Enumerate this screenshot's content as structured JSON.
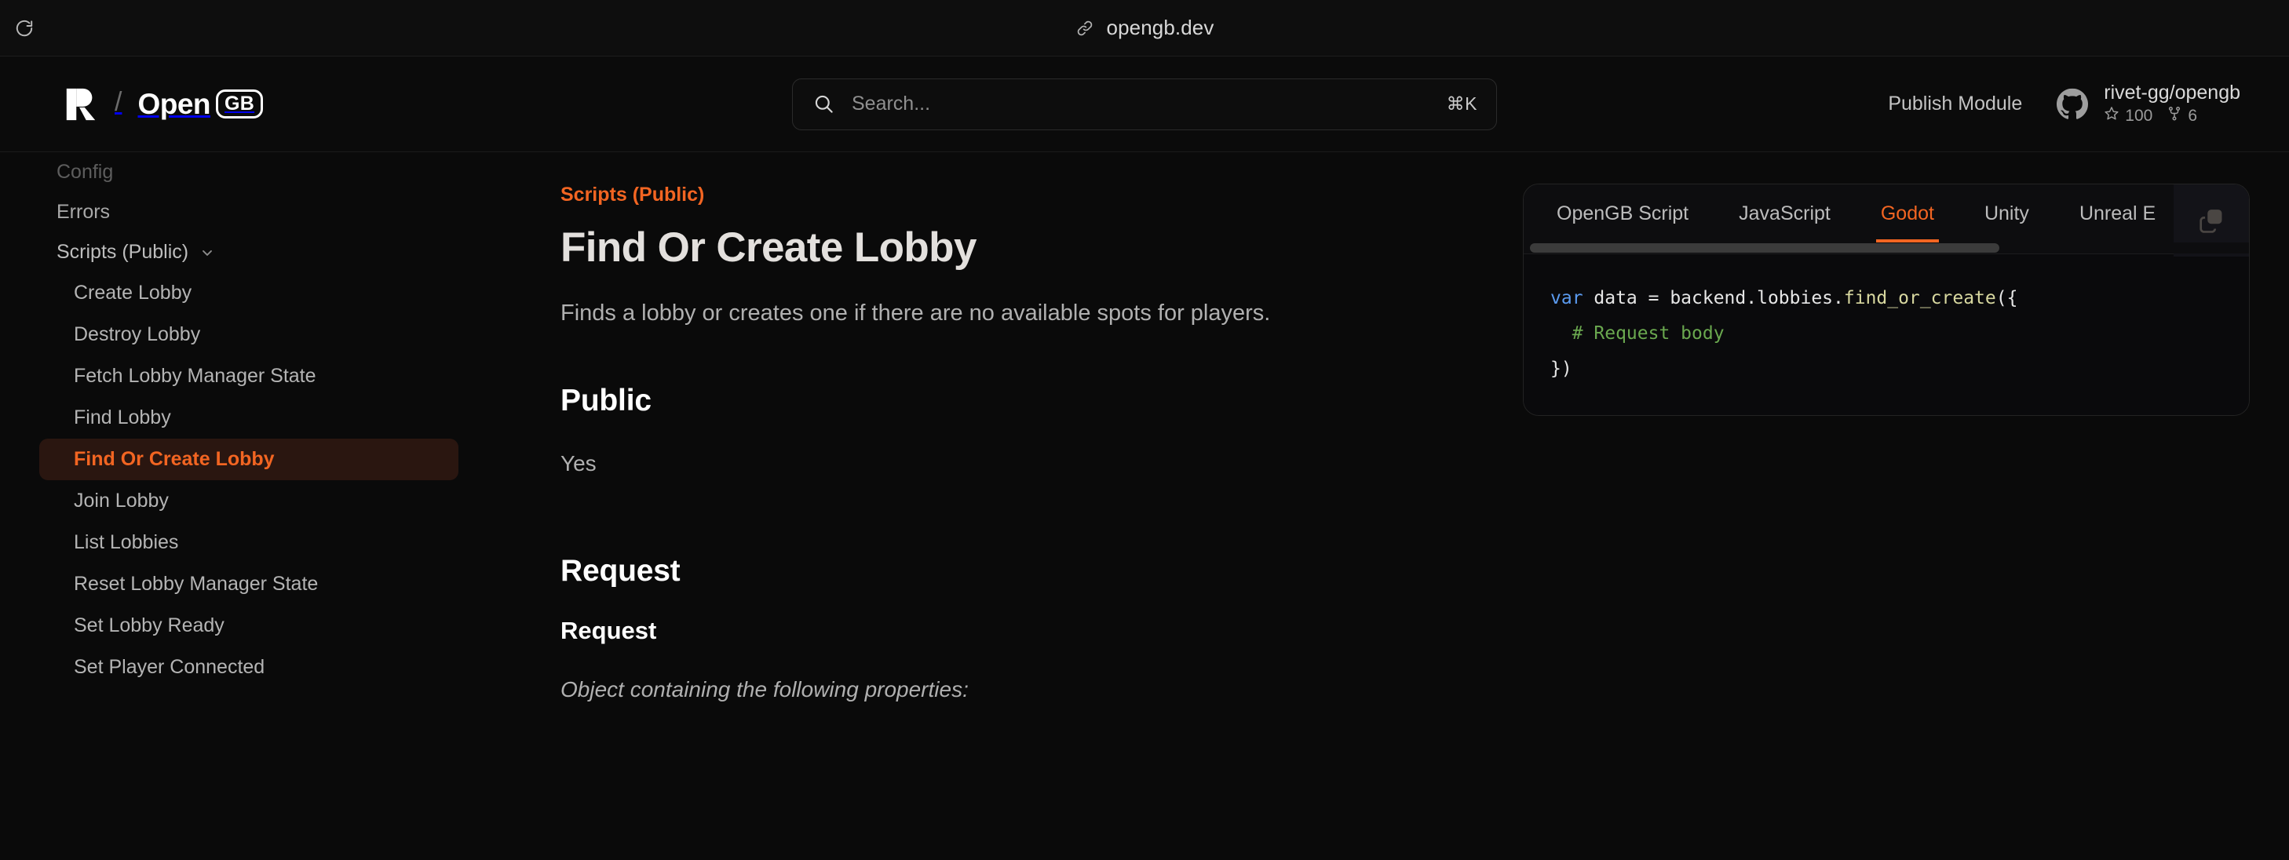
{
  "browser": {
    "reload_icon": "reload-icon",
    "link_icon": "link-icon",
    "url": "opengb.dev"
  },
  "header": {
    "brand": {
      "logo_icon": "rivet-logo-icon",
      "separator": "/",
      "product_word": "Open",
      "product_badge": "GB"
    },
    "search": {
      "icon": "search-icon",
      "value": "",
      "placeholder": "Search...",
      "shortcut": "⌘K"
    },
    "publish_label": "Publish Module",
    "repo": {
      "icon": "github-icon",
      "name": "rivet-gg/opengb",
      "stars_icon": "star-icon",
      "stars": "100",
      "forks_icon": "fork-icon",
      "forks": "6"
    }
  },
  "sidebar": {
    "items": [
      {
        "label": "Config",
        "type": "top",
        "state": "muted"
      },
      {
        "label": "Errors",
        "type": "top",
        "state": "normal"
      }
    ],
    "group": {
      "label": "Scripts (Public)",
      "chevron_icon": "chevron-down-icon",
      "items": [
        {
          "label": "Create Lobby",
          "active": false
        },
        {
          "label": "Destroy Lobby",
          "active": false
        },
        {
          "label": "Fetch Lobby Manager State",
          "active": false
        },
        {
          "label": "Find Lobby",
          "active": false
        },
        {
          "label": "Find Or Create Lobby",
          "active": true
        },
        {
          "label": "Join Lobby",
          "active": false
        },
        {
          "label": "List Lobbies",
          "active": false
        },
        {
          "label": "Reset Lobby Manager State",
          "active": false
        },
        {
          "label": "Set Lobby Ready",
          "active": false
        },
        {
          "label": "Set Player Connected",
          "active": false
        }
      ]
    }
  },
  "doc": {
    "eyebrow": "Scripts (Public)",
    "title": "Find Or Create Lobby",
    "lead": "Finds a lobby or creates one if there are no available spots for players.",
    "public_heading": "Public",
    "public_value": "Yes",
    "request_heading": "Request",
    "request_subheading": "Request",
    "request_note": "Object containing the following properties:"
  },
  "code_panel": {
    "tabs": [
      {
        "label": "OpenGB Script",
        "active": false
      },
      {
        "label": "JavaScript",
        "active": false
      },
      {
        "label": "Godot",
        "active": true
      },
      {
        "label": "Unity",
        "active": false
      },
      {
        "label": "Unreal E",
        "active": false
      }
    ],
    "copy_icon": "copy-icon",
    "copy_label": "Copy",
    "scrollbar": "horizontal-scrollbar",
    "code": {
      "line1_kw": "var",
      "line1_mid": " data = backend.lobbies.",
      "line1_fn": "find_or_create",
      "line1_end": "({",
      "line2_comment": "  # Request body",
      "line3": "})"
    },
    "accent_color": "#f26522"
  }
}
